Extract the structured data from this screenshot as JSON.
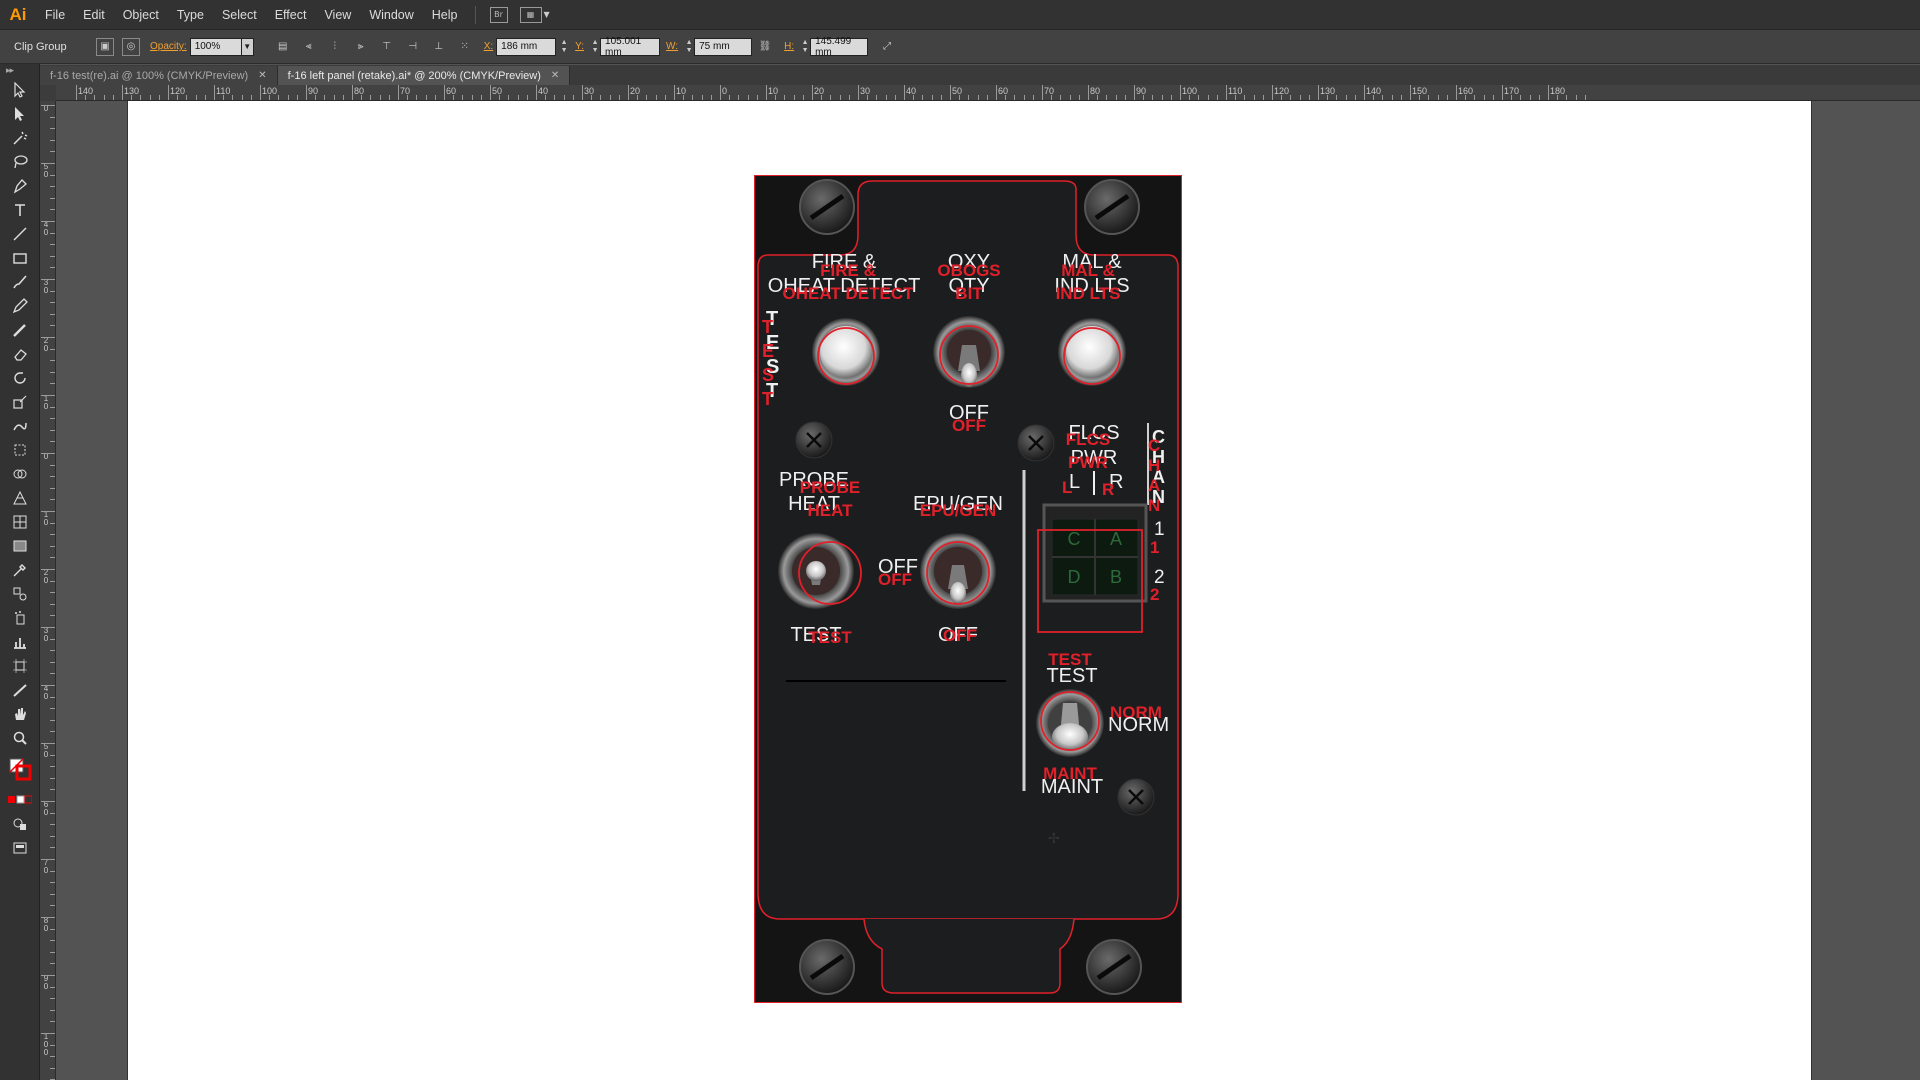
{
  "app": {
    "logo": "Ai",
    "menu": [
      "File",
      "Edit",
      "Object",
      "Type",
      "Select",
      "Effect",
      "View",
      "Window",
      "Help"
    ],
    "bridge_icon": "Br",
    "workspace_icon": "layout-grid-icon"
  },
  "control_bar": {
    "selection": "Clip Group",
    "opacity_label": "Opacity:",
    "opacity_value": "100%",
    "x_label": "X:",
    "x_value": "186 mm",
    "y_label": "Y:",
    "y_value": "105.001 mm",
    "w_label": "W:",
    "w_value": "75 mm",
    "h_label": "H:",
    "h_value": "145.499 mm"
  },
  "tabs": [
    {
      "label": "f-16 test(re).ai @ 100% (CMYK/Preview)",
      "active": false
    },
    {
      "label": "f-16 left panel (retake).ai* @ 200% (CMYK/Preview)",
      "active": true
    }
  ],
  "ruler": {
    "h_labels": [
      "140",
      "130",
      "120",
      "110",
      "100",
      "90",
      "80",
      "70",
      "60",
      "50",
      "40",
      "30",
      "20",
      "10",
      "0",
      "10",
      "20",
      "30",
      "40",
      "50",
      "60",
      "70",
      "80",
      "90",
      "100",
      "110",
      "120",
      "130",
      "140",
      "150",
      "160",
      "170",
      "180"
    ],
    "v_labels": [
      "0",
      "5 0",
      "4 0",
      "3 0",
      "2 0",
      "1 0",
      "0",
      "1 0",
      "2 0",
      "3 0",
      "4 0",
      "5 0",
      "6 0",
      "7 0",
      "8 0",
      "9 0",
      "1 0 0"
    ]
  },
  "panel": {
    "fire_line1": "FIRE &",
    "fire_line2": "OHEAT DETECT",
    "fire_red_line1": "FIRE &",
    "fire_red_line2": "OHEAT DETECT",
    "oxy_line1": "OXY",
    "oxy_line2": "QTY",
    "oxy_red_line1": "OBOGS",
    "oxy_red_line2": "BIT",
    "mal_line1": "MAL &",
    "mal_line2": "IND LTS",
    "mal_red_line1": "MAL &",
    "mal_red_line2": "IND LTS",
    "test_vertical": "TEST",
    "oxy_off": "OFF",
    "oxy_off_red": "OFF",
    "probe_line1": "PROBE",
    "probe_line2": "HEAT",
    "probe_red_line1": "PROBE",
    "probe_red_line2": "HEAT",
    "probe_off": "OFF",
    "probe_off_red": "OFF",
    "probe_test": "TEST",
    "probe_test_red": "TEST",
    "epu_label": "EPU/GEN",
    "epu_red_label": "EPU/GEN",
    "epu_off": "OFF",
    "epu_off_red": "OFF",
    "flcs_line1": "FLCS",
    "flcs_line2": "PWR",
    "flcs_red_line1": "FLCS",
    "flcs_red_line2": "PWR",
    "flcs_l": "L",
    "flcs_r": "R",
    "flcs_l_red": "L",
    "flcs_r_red": "R",
    "chan_vertical": "CHAN",
    "chan_digits": [
      "1",
      "2"
    ],
    "chan_digits_red": [
      "1",
      "2"
    ],
    "grid_cells": [
      "C",
      "A",
      "D",
      "B"
    ],
    "flcs_test": "TEST",
    "flcs_test_red": "TEST",
    "flcs_norm": "NORM",
    "flcs_norm_red": "NORM",
    "flcs_maint": "MAINT",
    "flcs_maint_red": "MAINT"
  }
}
